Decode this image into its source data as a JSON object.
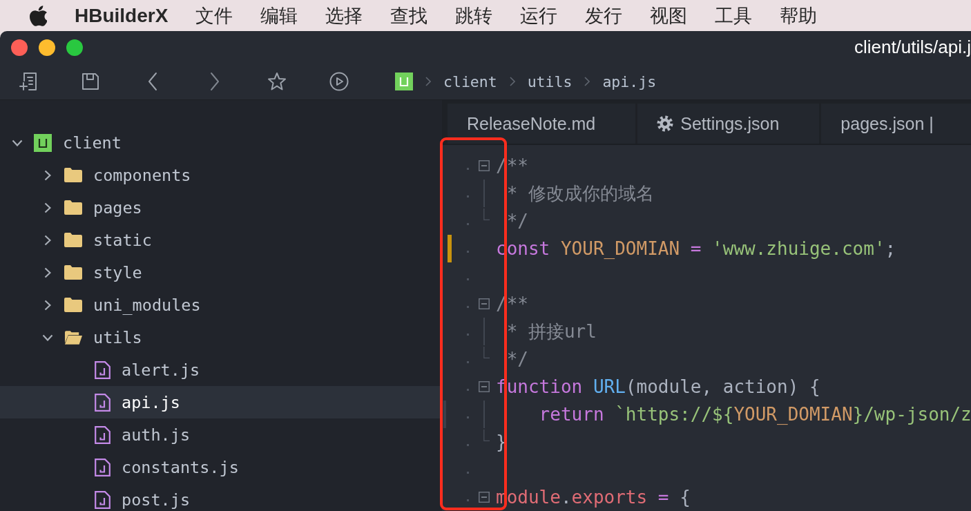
{
  "menu_bar": {
    "app_name": "HBuilderX",
    "items": [
      "文件",
      "编辑",
      "选择",
      "查找",
      "跳转",
      "运行",
      "发行",
      "视图",
      "工具",
      "帮助"
    ]
  },
  "window": {
    "title": "client/utils/api.j"
  },
  "breadcrumb": [
    "client",
    "utils",
    "api.js"
  ],
  "sidebar": {
    "tree": [
      {
        "label": "client",
        "kind": "project",
        "expanded": true,
        "selected": false,
        "children": [
          {
            "label": "components",
            "kind": "folder",
            "expanded": false,
            "selected": false
          },
          {
            "label": "pages",
            "kind": "folder",
            "expanded": false,
            "selected": false
          },
          {
            "label": "static",
            "kind": "folder",
            "expanded": false,
            "selected": false
          },
          {
            "label": "style",
            "kind": "folder",
            "expanded": false,
            "selected": false
          },
          {
            "label": "uni_modules",
            "kind": "folder",
            "expanded": false,
            "selected": false
          },
          {
            "label": "utils",
            "kind": "folder",
            "expanded": true,
            "selected": false,
            "children": [
              {
                "label": "alert.js",
                "kind": "file",
                "selected": false
              },
              {
                "label": "api.js",
                "kind": "file",
                "selected": true
              },
              {
                "label": "auth.js",
                "kind": "file",
                "selected": false
              },
              {
                "label": "constants.js",
                "kind": "file",
                "selected": false
              },
              {
                "label": "post.js",
                "kind": "file",
                "selected": false
              }
            ]
          }
        ]
      }
    ]
  },
  "tabs": [
    {
      "label": "ReleaseNote.md",
      "kind": "file",
      "selected": false
    },
    {
      "label": "Settings.json",
      "kind": "settings",
      "selected": false
    },
    {
      "label": "pages.json |",
      "kind": "file",
      "selected": false
    }
  ],
  "editor": {
    "annotation": {
      "kind": "frame"
    },
    "lines": [
      {
        "kind": "fold",
        "modified": false,
        "flagged": false,
        "tokens": [
          {
            "text": "/**",
            "kind": "comment"
          }
        ]
      },
      {
        "kind": "guide",
        "modified": false,
        "flagged": false,
        "tokens": [
          {
            "text": " * 修改成你的域名",
            "kind": "comment"
          }
        ]
      },
      {
        "kind": "guide-end",
        "modified": false,
        "flagged": false,
        "tokens": [
          {
            "text": " */",
            "kind": "comment"
          }
        ]
      },
      {
        "kind": "blank",
        "modified": true,
        "flagged": false,
        "tokens": [
          {
            "text": "const ",
            "kind": "keyword"
          },
          {
            "text": "YOUR_DOMIAN ",
            "kind": "constant"
          },
          {
            "text": "= ",
            "kind": "operator"
          },
          {
            "text": "'www.zhuige.com'",
            "kind": "string"
          },
          {
            "text": ";",
            "kind": "plain"
          }
        ]
      },
      {
        "kind": "blank",
        "modified": false,
        "flagged": false
      },
      {
        "kind": "fold",
        "modified": false,
        "flagged": false,
        "tokens": [
          {
            "text": "/**",
            "kind": "comment"
          }
        ]
      },
      {
        "kind": "guide",
        "modified": false,
        "flagged": false,
        "tokens": [
          {
            "text": " * 拼接url",
            "kind": "comment"
          }
        ]
      },
      {
        "kind": "guide-end",
        "modified": false,
        "flagged": false,
        "tokens": [
          {
            "text": " */",
            "kind": "comment"
          }
        ]
      },
      {
        "kind": "fold",
        "modified": false,
        "flagged": false,
        "tokens": [
          {
            "text": "function ",
            "kind": "keyword"
          },
          {
            "text": "URL",
            "kind": "function"
          },
          {
            "text": "(module, action) {",
            "kind": "plain"
          }
        ]
      },
      {
        "kind": "guide",
        "modified": false,
        "flagged": true,
        "tokens": [
          {
            "text": "    return ",
            "kind": "keyword"
          },
          {
            "text": "`https://${",
            "kind": "string"
          },
          {
            "text": "YOUR_DOMIAN",
            "kind": "constant"
          },
          {
            "text": "}/wp-json/z",
            "kind": "string"
          }
        ]
      },
      {
        "kind": "guide-end",
        "modified": false,
        "flagged": false,
        "tokens": [
          {
            "text": "}",
            "kind": "plain"
          }
        ]
      },
      {
        "kind": "blank",
        "modified": false,
        "flagged": false
      },
      {
        "kind": "fold",
        "modified": false,
        "flagged": false,
        "tokens": [
          {
            "text": "module",
            "kind": "variable"
          },
          {
            "text": ".",
            "kind": "plain"
          },
          {
            "text": "exports ",
            "kind": "variable"
          },
          {
            "text": "= ",
            "kind": "operator"
          },
          {
            "text": "{",
            "kind": "plain"
          }
        ]
      }
    ]
  }
}
